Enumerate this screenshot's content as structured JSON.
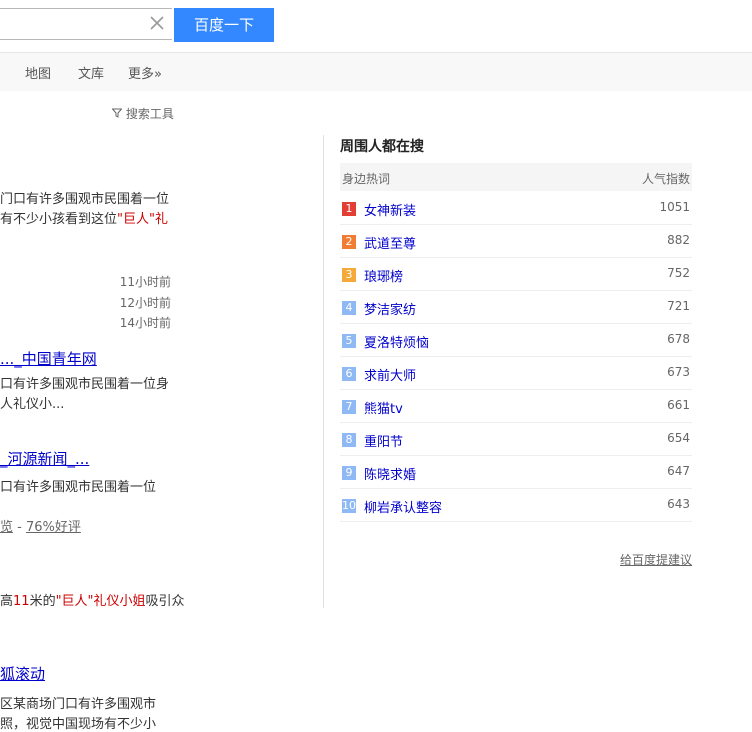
{
  "search": {
    "button_label": "百度一下"
  },
  "tabs": [
    "地图",
    "文库",
    "更多»"
  ],
  "tools_label": "搜索工具",
  "results": {
    "r1_line1": "门口有许多围观市民围着一位",
    "r1_line2a": "有不少小孩看到这位",
    "r1_line2b": "\"巨人\"礼",
    "times": [
      "11小时前",
      "12小时前",
      "14小时前"
    ],
    "r2_title": "..._中国青年网",
    "r2_line1": "口有许多围观市民围着一位身",
    "r2_line2": "人礼仪小...",
    "r3_title": "_河源新闻_...",
    "r3_line1": "口有许多围观市民围着一位",
    "r3_meta_a": "览",
    "r3_meta_sep": " - ",
    "r3_meta_b": "76%好评",
    "r4_line_a": "高",
    "r4_line_b": "11",
    "r4_line_c": "米的",
    "r4_line_d": "\"巨人\"礼仪小姐",
    "r4_line_e": "吸引众",
    "r5_title": "狐滚动",
    "r5_line1": "区某商场门口有许多围观市",
    "r5_line2": "照，视觉中国现场有不少小"
  },
  "hot": {
    "title": "周围人都在搜",
    "col_term": "身边热词",
    "col_index": "人气指数",
    "items": [
      {
        "rank": "1",
        "name": "女神新装",
        "score": "1051",
        "color": "#e33e33"
      },
      {
        "rank": "2",
        "name": "武道至尊",
        "score": "882",
        "color": "#f17d34"
      },
      {
        "rank": "3",
        "name": "琅琊榜",
        "score": "752",
        "color": "#f4a93a"
      },
      {
        "rank": "4",
        "name": "梦洁家纺",
        "score": "721",
        "color": "#8eb9f5"
      },
      {
        "rank": "5",
        "name": "夏洛特烦恼",
        "score": "678",
        "color": "#8eb9f5"
      },
      {
        "rank": "6",
        "name": "求前大师",
        "score": "673",
        "color": "#8eb9f5"
      },
      {
        "rank": "7",
        "name": "熊猫tv",
        "score": "661",
        "color": "#8eb9f5"
      },
      {
        "rank": "8",
        "name": "重阳节",
        "score": "654",
        "color": "#8eb9f5"
      },
      {
        "rank": "9",
        "name": "陈晓求婚",
        "score": "647",
        "color": "#8eb9f5"
      },
      {
        "rank": "10",
        "name": "柳岩承认整容",
        "score": "643",
        "color": "#8eb9f5"
      }
    ],
    "feedback": "给百度提建议"
  }
}
